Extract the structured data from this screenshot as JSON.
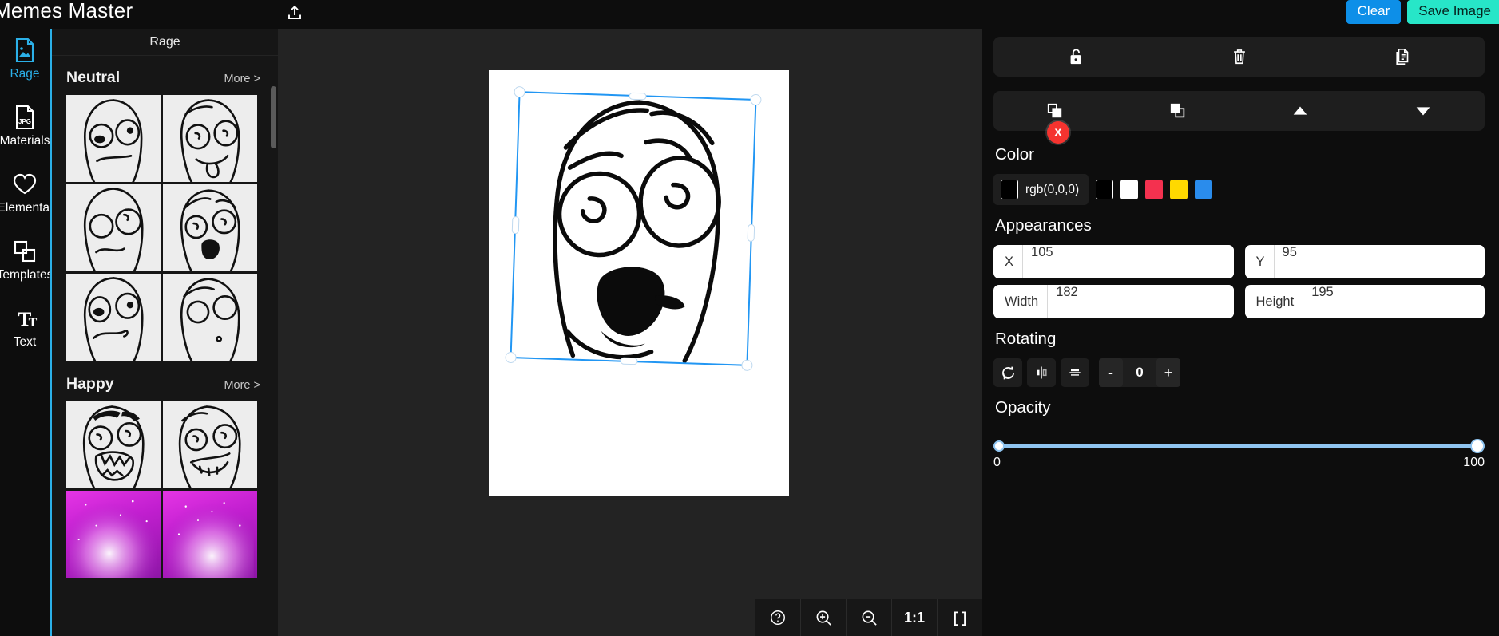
{
  "app": {
    "title": "Memes Master"
  },
  "topbar": {
    "upload_icon": "upload-icon",
    "clear_label": "Clear",
    "save_label": "Save Image",
    "clear_color": "#0d8fe8",
    "save_color": "#27e6c8"
  },
  "rail": {
    "items": [
      {
        "label": "Rage",
        "icon": "image-file-icon",
        "active": true
      },
      {
        "label": "Materials",
        "icon": "jpg-file-icon",
        "active": false
      },
      {
        "label": "Elemental",
        "icon": "heart-icon",
        "active": false
      },
      {
        "label": "Templates",
        "icon": "layers-icon",
        "active": false
      },
      {
        "label": "Text",
        "icon": "text-icon",
        "active": false
      }
    ]
  },
  "category_panel": {
    "header": "Rage",
    "groups": [
      {
        "title": "Neutral",
        "more_label": "More >",
        "thumb_count": 6
      },
      {
        "title": "Happy",
        "more_label": "More >",
        "thumb_count": 4
      }
    ]
  },
  "canvas": {
    "bottom_toolbar": [
      {
        "label": "",
        "icon": "help-circle-icon",
        "name": "help-button"
      },
      {
        "label": "",
        "icon": "zoom-in-icon",
        "name": "zoom-in-button"
      },
      {
        "label": "",
        "icon": "zoom-out-icon",
        "name": "zoom-out-button"
      },
      {
        "label": "1:1",
        "icon": "actual-size-icon",
        "name": "actual-size-button"
      },
      {
        "label": "[ ]",
        "icon": "fit-screen-icon",
        "name": "fit-screen-button"
      }
    ],
    "delete_label": "x"
  },
  "right_panel": {
    "object_tools": [
      {
        "name": "lock-icon",
        "label": ""
      },
      {
        "name": "trash-icon",
        "label": ""
      },
      {
        "name": "duplicate-icon",
        "label": ""
      }
    ],
    "layer_tools": [
      {
        "name": "bring-to-front-icon",
        "label": ""
      },
      {
        "name": "send-to-back-icon",
        "label": ""
      },
      {
        "name": "move-up-icon",
        "label": ""
      },
      {
        "name": "move-down-icon",
        "label": ""
      }
    ],
    "color": {
      "title": "Color",
      "current_value": "rgb(0,0,0)",
      "current_hex": "#000000",
      "swatches": [
        "#000000",
        "#ffffff",
        "#f4314f",
        "#ffd900",
        "#2a8cec"
      ]
    },
    "appearances": {
      "title": "Appearances",
      "x_label": "X",
      "x_value": "105",
      "y_label": "Y",
      "y_value": "95",
      "width_label": "Width",
      "width_value": "182",
      "height_label": "Height",
      "height_value": "195"
    },
    "rotating": {
      "title": "Rotating",
      "rotate_icon": "rotate-icon",
      "flip_h_icon": "flip-horizontal-icon",
      "flip_v_icon": "flip-vertical-icon",
      "minus_label": "-",
      "value": "0",
      "plus_label": "+"
    },
    "opacity": {
      "title": "Opacity",
      "min_label": "0",
      "max_label": "100",
      "min_value": 0,
      "max_value": 100
    }
  }
}
